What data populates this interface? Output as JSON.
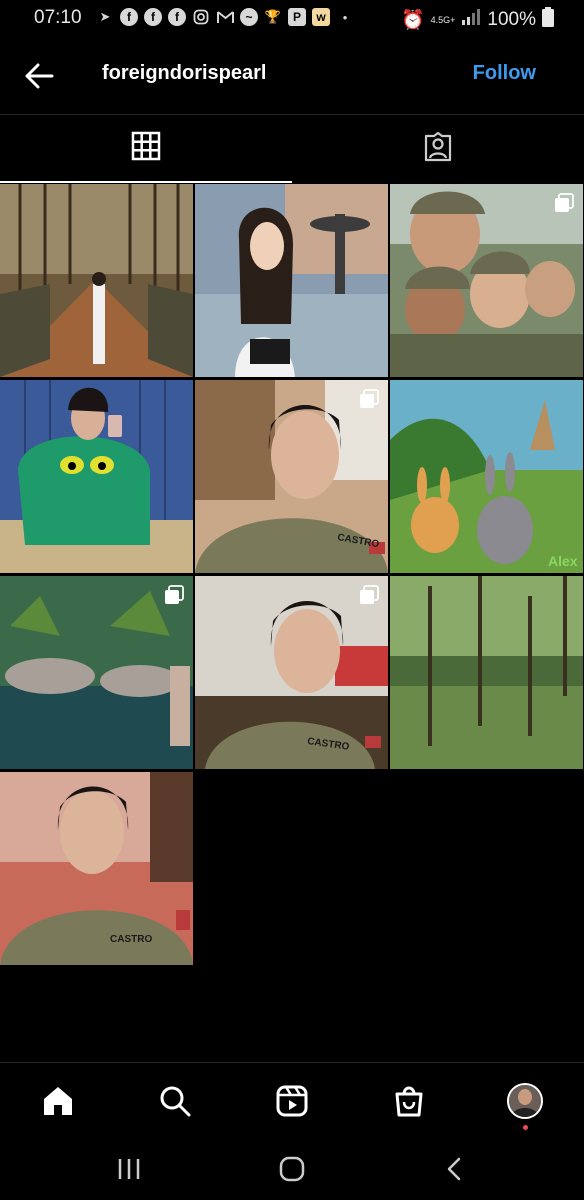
{
  "status_bar": {
    "time": "07:10",
    "network": "4.5G+",
    "battery": "100%",
    "notification_icons": [
      "telegram-icon",
      "facebook-icon",
      "facebook-icon",
      "facebook-icon",
      "instagram-icon",
      "gmail-icon",
      "messenger-icon",
      "trophy-icon",
      "p-app-icon",
      "w-app-icon",
      "dot-icon"
    ]
  },
  "header": {
    "username": "foreigndorispearl",
    "follow_label": "Follow"
  },
  "tabs": [
    {
      "name": "posts-grid-tab",
      "icon": "grid-icon",
      "selected": true
    },
    {
      "name": "tagged-tab",
      "icon": "tagged-person-icon",
      "selected": false
    }
  ],
  "posts": [
    {
      "subject": "forest path with woman in white jacket",
      "multi": false
    },
    {
      "subject": "woman by fountain",
      "multi": false
    },
    {
      "subject": "soldiers group selfie",
      "multi": true
    },
    {
      "subject": "woman in green grinch sweater by lockers",
      "multi": false
    },
    {
      "subject": "woman in uniform selfie, Castro",
      "multi": true
    },
    {
      "subject": "cartoon rabbits, Alex",
      "overlay_text": "Alex",
      "multi": false
    },
    {
      "subject": "rock pond with palms",
      "multi": true
    },
    {
      "subject": "woman in uniform selfie, Castro",
      "multi": true
    },
    {
      "subject": "green forest",
      "multi": false
    },
    {
      "subject": "woman in uniform close-up",
      "multi": false
    }
  ],
  "bottom_nav": [
    "home-icon",
    "search-icon",
    "reels-icon",
    "shop-icon",
    "profile-avatar"
  ],
  "colors": {
    "accent": "#3d9bef",
    "background": "#000000",
    "notification_dot": "#ed4956"
  }
}
